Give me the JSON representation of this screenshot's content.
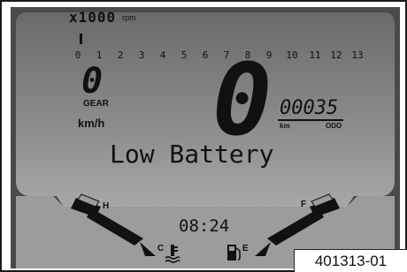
{
  "display": {
    "background": "#5f5f5f",
    "bezel": "#454545",
    "panel": "#8e8e8e",
    "segment_color": "#111111",
    "rpm_scale_label": "x1000",
    "rpm_unit": "rpm",
    "rpm_ticks": [
      "0",
      "1",
      "2",
      "3",
      "4",
      "5",
      "6",
      "7",
      "8",
      "9",
      "10",
      "11",
      "12",
      "13"
    ],
    "gear_value": "0",
    "gear_label": "GEAR",
    "speed_value": "0",
    "speed_unit": "km/h",
    "odometer_value": "00035",
    "odometer_unit": "km",
    "odometer_label": "ODO",
    "message": "Low Battery",
    "clock": "08:24",
    "temp_high_label": "H",
    "temp_cold_label": "C",
    "fuel_full_label": "F",
    "fuel_empty_label": "E",
    "coolant_icon": "coolant-temp-icon",
    "fuel_icon": "fuel-pump-icon"
  },
  "figure_id": "401313-01"
}
